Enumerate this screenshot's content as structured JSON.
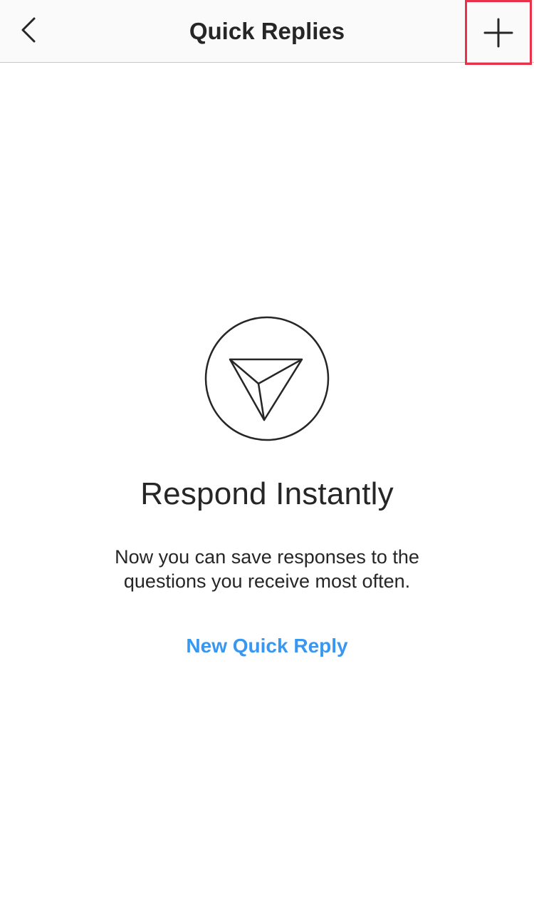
{
  "header": {
    "title": "Quick Replies",
    "back_icon": "chevron-left-icon",
    "add_icon": "plus-icon",
    "highlight_color": "#e8324a"
  },
  "empty_state": {
    "icon": "paper-plane-icon",
    "headline": "Respond Instantly",
    "description": "Now you can save responses to the questions you receive most often.",
    "cta_label": "New Quick Reply",
    "cta_color": "#3897f0"
  }
}
